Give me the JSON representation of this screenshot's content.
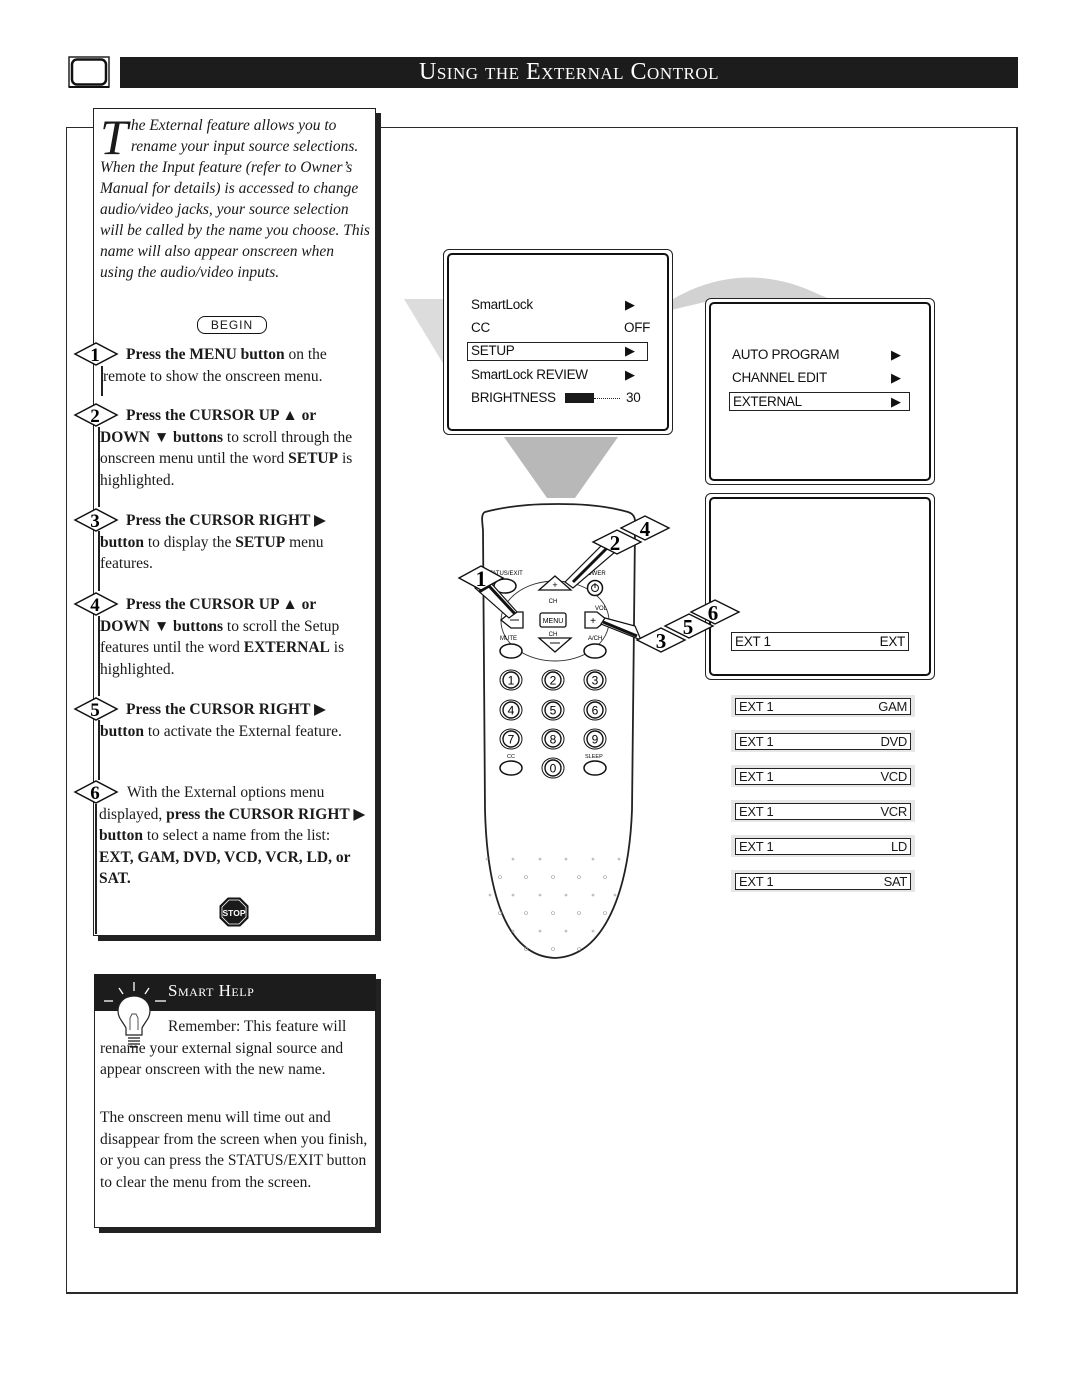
{
  "header": {
    "title": "Using the External Control",
    "icon": "tv-icon"
  },
  "intro": {
    "dropcap": "T",
    "text": "he External feature allows you to rename your input source selections. When the Input feature (refer to Owner’s Manual for details) is accessed to change audio/video jacks, your source selection will be called by the name you choose. This name will also appear onscreen when using the audio/video inputs.",
    "begin_label": "BEGIN"
  },
  "steps": [
    {
      "number": "1",
      "bold": "Press the MENU button",
      "rest": " on the remote to show the onscreen menu."
    },
    {
      "number": "2",
      "bold": "Press the CURSOR UP ▲ or DOWN ▼ buttons",
      "rest": " to scroll through the onscreen menu until the word ",
      "bold2": "SETUP",
      "rest2": " is highlighted."
    },
    {
      "number": "3",
      "bold": "Press the CURSOR RIGHT ▶ button",
      "rest": " to display the ",
      "bold2": "SETUP",
      "rest2": " menu features."
    },
    {
      "number": "4",
      "bold": "Press the CURSOR UP ▲ or DOWN ▼ buttons",
      "rest": " to scroll the Setup features until the word ",
      "bold2": "EXTERNAL",
      "rest2": " is highlighted."
    },
    {
      "number": "5",
      "bold": "Press the CURSOR RIGHT ▶ button",
      "rest": " to activate the External feature."
    },
    {
      "number": "6",
      "pre": "With the External options menu displayed, ",
      "bold": "press the CURSOR RIGHT ▶ button",
      "rest": " to select a name from the list: ",
      "bold2": "EXT, GAM, DVD, VCD, VCR, LD, or SAT."
    }
  ],
  "stop_label": "STOP",
  "smart_help": {
    "title": "Smart Help",
    "para1": "Remember: This feature will rename your external signal source and appear onscreen with the new name.",
    "para2": "The onscreen menu will time out and disappear from the screen when you finish, or you can press the STATUS/EXIT button to clear the menu from the screen."
  },
  "main_menu": {
    "items": [
      {
        "label": "SmartLock",
        "value": "▶",
        "highlighted": false
      },
      {
        "label": "CC",
        "value": "OFF",
        "highlighted": false
      },
      {
        "label": "SETUP",
        "value": "▶",
        "highlighted": true
      },
      {
        "label": "SmartLock REVIEW",
        "value": "▶",
        "highlighted": false
      },
      {
        "label": "BRIGHTNESS",
        "value": "30",
        "highlighted": false
      }
    ],
    "brightness_level": 30
  },
  "setup_menu": {
    "items": [
      {
        "label": "AUTO PROGRAM",
        "value": "▶",
        "highlighted": false
      },
      {
        "label": "CHANNEL EDIT",
        "value": "▶",
        "highlighted": false
      },
      {
        "label": "EXTERNAL",
        "value": "▶",
        "highlighted": true
      }
    ]
  },
  "external_screen": {
    "source": "EXT 1",
    "value": "EXT"
  },
  "external_options": [
    {
      "source": "EXT 1",
      "value": "GAM"
    },
    {
      "source": "EXT 1",
      "value": "DVD"
    },
    {
      "source": "EXT 1",
      "value": "VCD"
    },
    {
      "source": "EXT 1",
      "value": "VCR"
    },
    {
      "source": "EXT 1",
      "value": "LD"
    },
    {
      "source": "EXT 1",
      "value": "SAT"
    }
  ],
  "remote": {
    "labels": {
      "status_exit": "STATUS/EXIT",
      "power": "POWER",
      "ch": "CH",
      "vol": "VOL",
      "menu": "MENU",
      "mute": "MUTE",
      "ach": "A/CH",
      "cc": "CC",
      "sleep": "SLEEP"
    },
    "digits": [
      "1",
      "2",
      "3",
      "4",
      "5",
      "6",
      "7",
      "8",
      "9",
      "0"
    ],
    "callouts": [
      "1",
      "2",
      "4",
      "3",
      "5",
      "6"
    ]
  }
}
